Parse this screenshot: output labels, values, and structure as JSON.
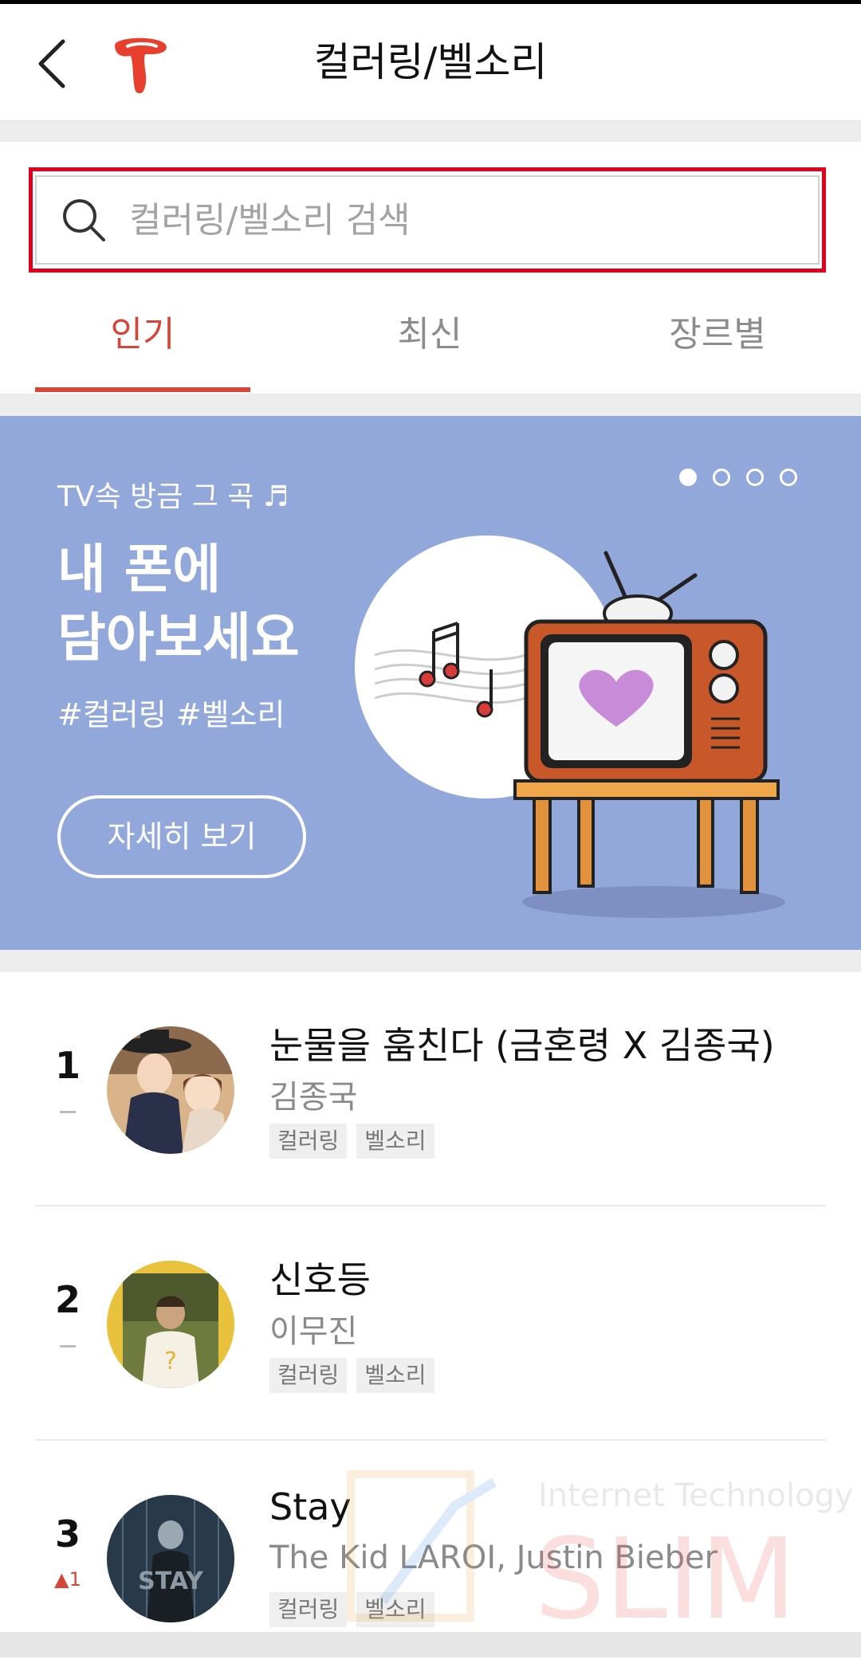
{
  "header": {
    "title": "컬러링/벨소리",
    "back_icon": "chevron-left-icon",
    "logo_icon": "t-logo-icon"
  },
  "search": {
    "placeholder": "컬러링/벨소리 검색",
    "value": "",
    "icon": "search-icon"
  },
  "tabs": [
    {
      "label": "인기",
      "active": true
    },
    {
      "label": "최신",
      "active": false
    },
    {
      "label": "장르별",
      "active": false
    }
  ],
  "banner": {
    "subtitle": "TV속 방금 그 곡 ♬",
    "title_line1": "내 폰에",
    "title_line2": "담아보세요",
    "tags": "#컬러링  #벨소리",
    "button_label": "자세히 보기",
    "pager_total": 4,
    "pager_current": 1,
    "background_color": "#93a8da"
  },
  "chart": [
    {
      "rank": "1",
      "change": "",
      "title": "눈물을 훔친다 (금혼령 X 김종국)",
      "artist": "김종국",
      "tags": [
        "컬러링",
        "벨소리"
      ]
    },
    {
      "rank": "2",
      "change": "",
      "title": "신호등",
      "artist": "이무진",
      "tags": [
        "컬러링",
        "벨소리"
      ]
    },
    {
      "rank": "3",
      "change": "▲1",
      "title": "Stay",
      "artist": "The Kid LAROI, Justin Bieber",
      "tags": [
        "컬러링",
        "벨소리"
      ]
    }
  ],
  "watermark": {
    "line1": "Internet Technology",
    "line2": "SLIM"
  },
  "colors": {
    "accent": "#d5463a",
    "highlight_box": "#e0001b"
  }
}
